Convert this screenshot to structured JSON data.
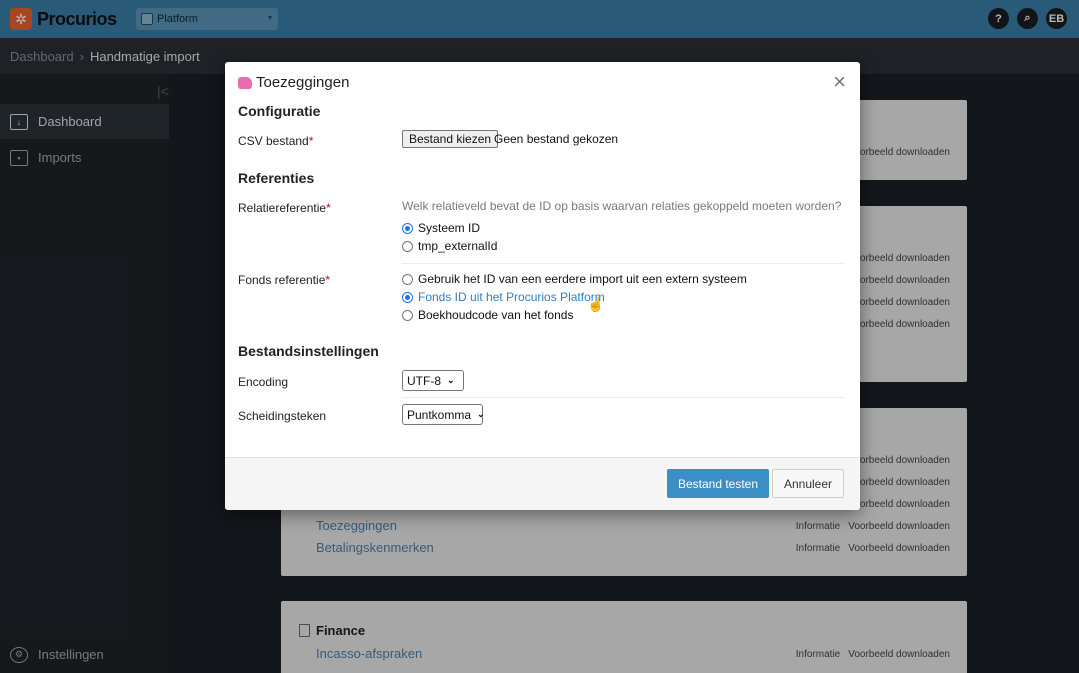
{
  "app": {
    "name": "Procurios",
    "platform": "Platform"
  },
  "topbar": {
    "help_label": "?",
    "search_label": "⌕",
    "avatar_initials": "EB"
  },
  "breadcrumb": {
    "root": "Dashboard",
    "sep": "›",
    "current": "Handmatige import"
  },
  "sidebar": {
    "collapse_glyph": "|<",
    "items": [
      {
        "label": "Dashboard"
      },
      {
        "label": "Imports"
      },
      {
        "label": "Instellingen"
      }
    ]
  },
  "background": {
    "rows": [
      {
        "info": "",
        "download": "Voorbeeld downloaden"
      },
      {
        "info": "",
        "download": "Voorbeeld downloaden"
      },
      {
        "info": "",
        "download": "Voorbeeld downloaden"
      },
      {
        "info": "",
        "download": "Voorbeeld downloaden"
      },
      {
        "info": "",
        "download": "Voorbeeld downloaden"
      },
      {
        "info": "",
        "download": "Voorbeeld downloaden"
      },
      {
        "info": "",
        "download": "Voorbeeld downloaden"
      },
      {
        "info": "",
        "download": "Voorbeeld downloaden"
      }
    ],
    "toezeggingen": {
      "label": "Toezeggingen",
      "info": "Informatie",
      "download": "Voorbeeld downloaden"
    },
    "betalingskenmerken": {
      "label": "Betalingskenmerken",
      "info": "Informatie",
      "download": "Voorbeeld downloaden"
    },
    "finance": {
      "title": "Finance",
      "incasso": {
        "label": "Incasso-afspraken",
        "info": "Informatie",
        "download": "Voorbeeld downloaden"
      }
    }
  },
  "modal": {
    "title": "Toezeggingen",
    "close": "×",
    "configuratie": "Configuratie",
    "csv_label": "CSV bestand",
    "required": "*",
    "file_button": "Bestand kiezen",
    "file_none": "Geen bestand gekozen",
    "referenties": "Referenties",
    "relatie_label": "Relatiereferentie",
    "relatie_hint": "Welk relatieveld bevat de ID op basis waarvan relaties gekoppeld moeten worden?",
    "relatie_options": [
      "Systeem ID",
      "tmp_externalId"
    ],
    "fonds_label": "Fonds referentie",
    "fonds_options": [
      "Gebruik het ID van een eerdere import uit een extern systeem",
      "Fonds ID uit het Procurios Platform",
      "Boekhoudcode van het fonds"
    ],
    "bestandsinstellingen": "Bestandsinstellingen",
    "encoding_label": "Encoding",
    "encoding_value": "UTF-8",
    "scheiding_label": "Scheidingsteken",
    "scheiding_value": "Puntkomma",
    "test_button": "Bestand testen",
    "cancel_button": "Annuleer"
  }
}
